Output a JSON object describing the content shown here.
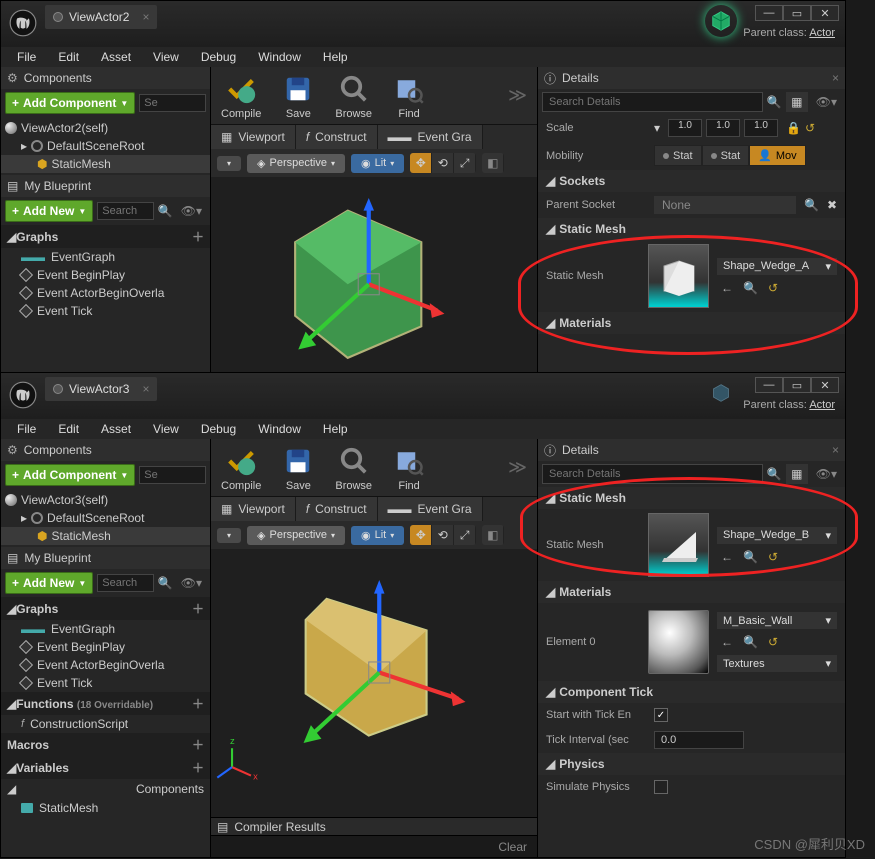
{
  "watermark": "CSDN @犀利贝XD",
  "win1": {
    "tab": "ViewActor2",
    "menu": [
      "File",
      "Edit",
      "Asset",
      "View",
      "Debug",
      "Window",
      "Help"
    ],
    "parent_class_label": "Parent class:",
    "parent_class": "Actor",
    "toolbar": {
      "compile": "Compile",
      "save": "Save",
      "browse": "Browse",
      "find": "Find"
    },
    "components": {
      "title": "Components",
      "add": "Add Component",
      "search_ph": "Se",
      "root": "ViewActor2(self)",
      "scene": "DefaultSceneRoot",
      "mesh": "StaticMesh"
    },
    "myblueprint": {
      "title": "My Blueprint",
      "addnew": "Add New",
      "search_ph": "Search"
    },
    "graphs": {
      "title": "Graphs",
      "eventgraph": "EventGraph",
      "e1": "Event BeginPlay",
      "e2": "Event ActorBeginOverla",
      "e3": "Event Tick"
    },
    "subtabs": {
      "viewport": "Viewport",
      "construct": "Construct",
      "eventgra": "Event Gra"
    },
    "vp": {
      "perspective": "Perspective",
      "lit": "Lit"
    },
    "details": {
      "title": "Details",
      "search_ph": "Search Details",
      "scale_label": "Scale",
      "scale": [
        "1.0",
        "1.0",
        "1.0"
      ],
      "mobility_label": "Mobility",
      "mobility": [
        "Stat",
        "Stat",
        "Mov"
      ],
      "sockets": "Sockets",
      "parent_socket": "Parent Socket",
      "none": "None",
      "staticmesh_sec": "Static Mesh",
      "staticmesh_label": "Static Mesh",
      "staticmesh_val": "Shape_Wedge_A",
      "materials": "Materials"
    }
  },
  "win2": {
    "tab": "ViewActor3",
    "menu": [
      "File",
      "Edit",
      "Asset",
      "View",
      "Debug",
      "Window",
      "Help"
    ],
    "parent_class_label": "Parent class:",
    "parent_class": "Actor",
    "toolbar": {
      "compile": "Compile",
      "save": "Save",
      "browse": "Browse",
      "find": "Find"
    },
    "components": {
      "title": "Components",
      "add": "Add Component",
      "search_ph": "Se",
      "root": "ViewActor3(self)",
      "scene": "DefaultSceneRoot",
      "mesh": "StaticMesh"
    },
    "myblueprint": {
      "title": "My Blueprint",
      "addnew": "Add New",
      "search_ph": "Search"
    },
    "graphs": {
      "title": "Graphs",
      "eventgraph": "EventGraph",
      "e1": "Event BeginPlay",
      "e2": "Event ActorBeginOverla",
      "e3": "Event Tick"
    },
    "functions": {
      "title": "Functions",
      "override": "(18 Overridable)",
      "item": "ConstructionScript"
    },
    "macros": "Macros",
    "variables": "Variables",
    "comps": "Components",
    "sm": "StaticMesh",
    "subtabs": {
      "viewport": "Viewport",
      "construct": "Construct",
      "eventgra": "Event Gra"
    },
    "vp": {
      "perspective": "Perspective",
      "lit": "Lit"
    },
    "compiler": "Compiler Results",
    "clear": "Clear",
    "details": {
      "title": "Details",
      "search_ph": "Search Details",
      "staticmesh_sec": "Static Mesh",
      "staticmesh_label": "Static Mesh",
      "staticmesh_val": "Shape_Wedge_B",
      "materials": "Materials",
      "element0": "Element 0",
      "mat_val": "M_Basic_Wall",
      "textures": "Textures",
      "comptick": "Component Tick",
      "starttick": "Start with Tick En",
      "tickint": "Tick Interval (sec",
      "tickint_val": "0.0",
      "physics": "Physics",
      "simphys": "Simulate Physics"
    }
  }
}
